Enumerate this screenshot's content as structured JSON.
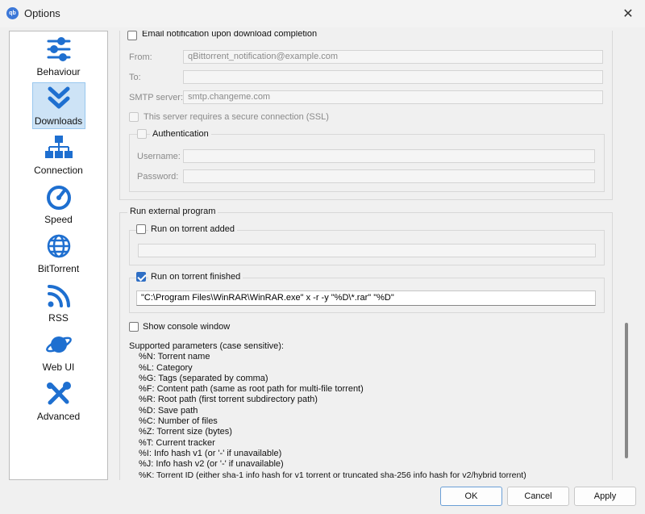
{
  "window": {
    "title": "Options",
    "icon_text": "qb"
  },
  "sidebar": {
    "items": [
      {
        "label": "Behaviour",
        "icon": "sliders-icon"
      },
      {
        "label": "Downloads",
        "icon": "double-chevron-down-icon",
        "active": true
      },
      {
        "label": "Connection",
        "icon": "network-icon"
      },
      {
        "label": "Speed",
        "icon": "speedometer-icon"
      },
      {
        "label": "BitTorrent",
        "icon": "globe-icon"
      },
      {
        "label": "RSS",
        "icon": "rss-icon"
      },
      {
        "label": "Web UI",
        "icon": "planet-icon"
      },
      {
        "label": "Advanced",
        "icon": "tools-icon"
      }
    ]
  },
  "email": {
    "notification_label": "Email notification upon download completion",
    "from_label": "From:",
    "from_value": "qBittorrent_notification@example.com",
    "to_label": "To:",
    "to_value": "",
    "smtp_label": "SMTP server:",
    "smtp_value": "smtp.changeme.com",
    "ssl_label": "This server requires a secure connection (SSL)",
    "auth_label": "Authentication",
    "username_label": "Username:",
    "username_value": "",
    "password_label": "Password:",
    "password_value": ""
  },
  "external": {
    "section_title": "Run external program",
    "added_label": "Run on torrent added",
    "added_value": "",
    "finished_label": "Run on torrent finished",
    "finished_value": "\"C:\\Program Files\\WinRAR\\WinRAR.exe\" x -r -y \"%D\\*.rar\" \"%D\"",
    "console_label": "Show console window"
  },
  "params": {
    "header": "Supported parameters (case sensitive):",
    "lines": [
      "%N: Torrent name",
      "%L: Category",
      "%G: Tags (separated by comma)",
      "%F: Content path (same as root path for multi-file torrent)",
      "%R: Root path (first torrent subdirectory path)",
      "%D: Save path",
      "%C: Number of files",
      "%Z: Torrent size (bytes)",
      "%T: Current tracker",
      "%I: Info hash v1 (or '-' if unavailable)",
      "%J: Info hash v2 (or '-' if unavailable)",
      "%K: Torrent ID (either sha-1 info hash for v1 torrent or truncated sha-256 info hash for v2/hybrid torrent)"
    ]
  },
  "buttons": {
    "ok": "OK",
    "cancel": "Cancel",
    "apply": "Apply"
  },
  "colors": {
    "accent": "#2f6fc5",
    "icon_blue": "#1e6fd0",
    "selection": "#cde3f6"
  }
}
